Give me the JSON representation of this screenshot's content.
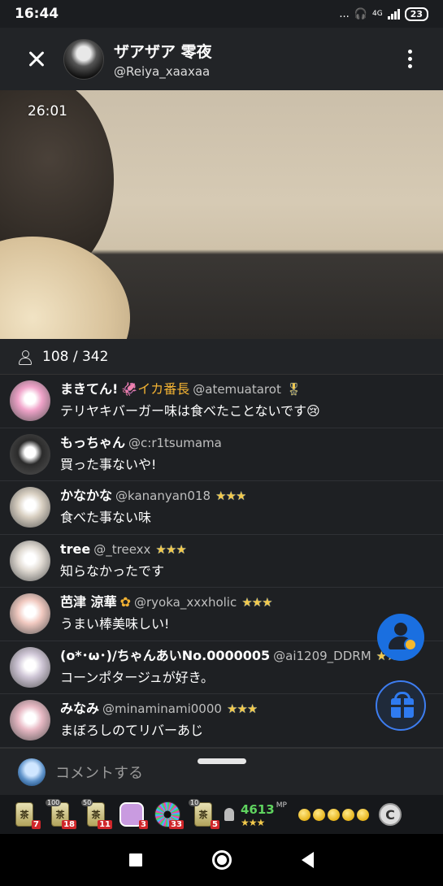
{
  "status_bar": {
    "time": "16:44",
    "indicators": "...",
    "network": "4G",
    "battery": "23"
  },
  "header": {
    "host_name": "ザアザア 零夜",
    "host_handle": "@Reiya_xaaxaa",
    "close_icon": "close-icon",
    "more_icon": "more-vertical-icon"
  },
  "video": {
    "elapsed": "26:01"
  },
  "viewers": {
    "count_text": "108 / 342"
  },
  "comments": [
    {
      "name": "まきてん!",
      "badge": "🦑イカ番長",
      "handle": "@atemuatarot",
      "stars": "🎖",
      "text": "テリヤキバーガー味は食べたことないです😢",
      "avatar_color": "#f0a3c9"
    },
    {
      "name": "もっちゃん",
      "badge": "",
      "handle": "@c:r1tsumama",
      "stars": "",
      "text": "買った事ないや!",
      "avatar_color": "#2b2b2b"
    },
    {
      "name": "かなかな",
      "badge": "",
      "handle": "@kananyan018",
      "stars": "★★★",
      "text": "食べた事ない味",
      "avatar_color": "#d9d0c2"
    },
    {
      "name": "tree",
      "badge": "",
      "handle": "@_treexx",
      "stars": "★★★",
      "text": "知らなかったです",
      "avatar_color": "#e1dbd3"
    },
    {
      "name": "芭津 涼華",
      "badge": "✿",
      "handle": "@ryoka_xxxholic",
      "stars": "★★★",
      "text": "うまい棒美味しい!",
      "avatar_color": "#f1c9c0"
    },
    {
      "name": "(o*･ω･)/ちゃんあいNo.0000005",
      "badge": "",
      "handle": "@ai1209_DDRM",
      "stars": "★★★",
      "text": "コーンポタージュが好き。",
      "avatar_color": "#cfc6d6"
    },
    {
      "name": "みなみ",
      "badge": "",
      "handle": "@minaminami0000",
      "stars": "★★★",
      "text": "まぼろしのてリバーあじ",
      "avatar_color": "#e8b9c4"
    }
  ],
  "input": {
    "placeholder": "コメントする"
  },
  "gift_tray": {
    "items": [
      {
        "label": "茶",
        "tag": "",
        "qty": "7"
      },
      {
        "label": "茶",
        "tag": "100",
        "qty": "18"
      },
      {
        "label": "茶",
        "tag": "50",
        "qty": "11"
      },
      {
        "label": "",
        "tag": "",
        "qty": "3"
      },
      {
        "label": "",
        "tag": "",
        "qty": "33"
      },
      {
        "label": "茶",
        "tag": "10",
        "qty": "5"
      }
    ],
    "mp_value": "4613",
    "mp_unit": "MP",
    "mp_stars": "★★★",
    "coin_label": "C"
  },
  "colors": {
    "accent_blue": "#1a6fe0",
    "star_gold": "#f2c94c",
    "mp_green": "#5fd35f"
  }
}
